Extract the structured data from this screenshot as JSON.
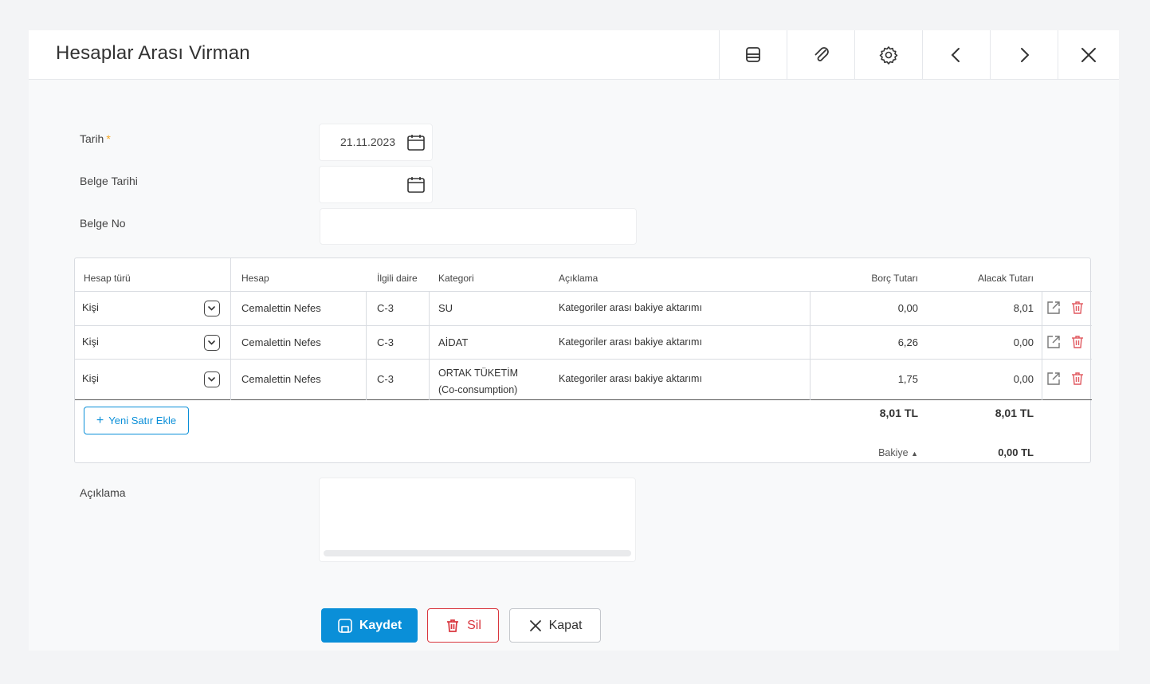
{
  "window": {
    "title": "Hesaplar Arası Virman"
  },
  "header_buttons": [
    "print-icon",
    "attachment-icon",
    "settings-icon",
    "chevron-left-icon",
    "chevron-right-icon",
    "close-icon"
  ],
  "form": {
    "date_label": "Tarih",
    "required_mark": "*",
    "date_value": "21.11.2023",
    "doc_date_label": "Belge Tarihi",
    "doc_date_value": "",
    "doc_no_label": "Belge No",
    "doc_no_value": "",
    "description_label": "Açıklama",
    "description_value": ""
  },
  "table": {
    "headers": {
      "account_type": "Hesap türü",
      "account": "Hesap",
      "unit": "İlgili daire",
      "category": "Kategori",
      "description": "Açıklama",
      "debit": "Borç Tutarı",
      "credit": "Alacak Tutarı"
    },
    "rows": [
      {
        "type": "Kişi",
        "account": "Cemalettin Nefes",
        "unit": "C-3",
        "category": "SU",
        "category2": "",
        "description": "Kategoriler arası bakiye aktarımı",
        "debit": "0,00",
        "credit": "8,01"
      },
      {
        "type": "Kişi",
        "account": "Cemalettin Nefes",
        "unit": "C-3",
        "category": "AİDAT",
        "category2": "",
        "description": "Kategoriler arası bakiye aktarımı",
        "debit": "6,26",
        "credit": "0,00"
      },
      {
        "type": "Kişi",
        "account": "Cemalettin Nefes",
        "unit": "C-3",
        "category": "ORTAK TÜKETİM",
        "category2": "(Co-consumption)",
        "description": "Kategoriler arası bakiye aktarımı",
        "debit": "1,75",
        "credit": "0,00"
      }
    ],
    "add_row_label": "Yeni Satır Ekle",
    "total_debit": "8,01 TL",
    "total_credit": "8,01 TL",
    "balance_label": "Bakiye",
    "balance_value": "0,00 TL"
  },
  "actions": {
    "save": "Kaydet",
    "delete": "Sil",
    "close": "Kapat"
  },
  "colors": {
    "primary": "#0a8fd8",
    "danger": "#d9363e",
    "required": "#f5a623"
  }
}
